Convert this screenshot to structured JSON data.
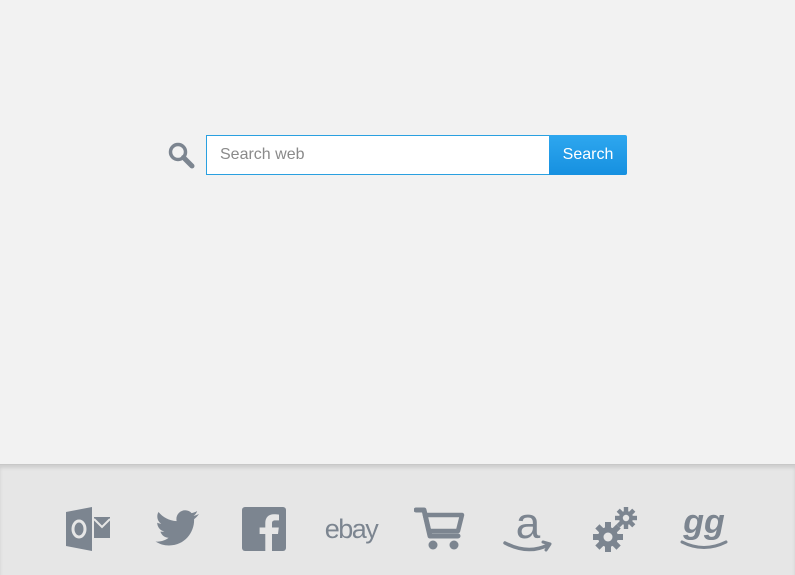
{
  "search": {
    "placeholder": "Search web",
    "button_label": "Search",
    "icon": "magnifier-icon"
  },
  "quick_links": [
    {
      "icon": "outlook-icon",
      "label": "Outlook"
    },
    {
      "icon": "twitter-icon",
      "label": "Twitter"
    },
    {
      "icon": "facebook-icon",
      "label": "Facebook"
    },
    {
      "icon": "ebay-icon",
      "label": "ebay"
    },
    {
      "icon": "shopping-cart-icon",
      "label": "Shopping"
    },
    {
      "icon": "amazon-icon",
      "label": "Amazon"
    },
    {
      "icon": "settings-gears-icon",
      "label": "Settings"
    },
    {
      "icon": "gg-icon",
      "label": "gg"
    }
  ],
  "colors": {
    "background": "#f2f2f2",
    "accent": "#1e9be8",
    "icon_gray": "#7c8590",
    "footer_bg": "#e6e6e6"
  }
}
